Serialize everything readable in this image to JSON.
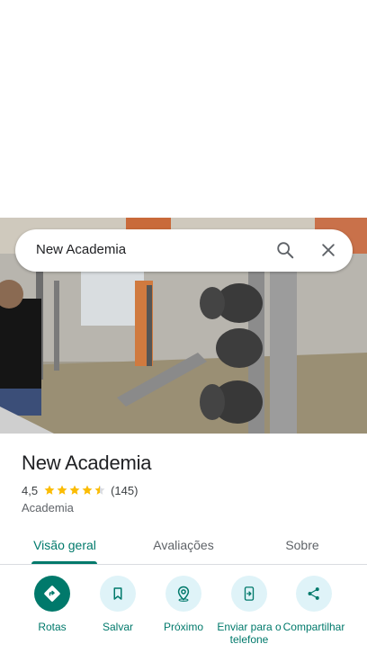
{
  "search": {
    "query": "New Academia",
    "search_icon": "search-icon",
    "close_icon": "close-icon"
  },
  "place": {
    "name": "New Academia",
    "rating": "4,5",
    "stars": 4.5,
    "reviews": "(145)",
    "category": "Academia"
  },
  "tabs": [
    {
      "label": "Visão geral",
      "active": true
    },
    {
      "label": "Avaliações",
      "active": false
    },
    {
      "label": "Sobre",
      "active": false
    }
  ],
  "actions": [
    {
      "label": "Rotas",
      "icon": "directions-icon"
    },
    {
      "label": "Salvar",
      "icon": "bookmark-icon"
    },
    {
      "label": "Próximo",
      "icon": "nearby-icon"
    },
    {
      "label": "Enviar para o telefone",
      "icon": "send-to-phone-icon"
    },
    {
      "label": "Compartilhar",
      "icon": "share-icon"
    }
  ],
  "colors": {
    "accent": "#00796b",
    "star": "#fbbc04",
    "action_bg": "#dff3f8"
  }
}
